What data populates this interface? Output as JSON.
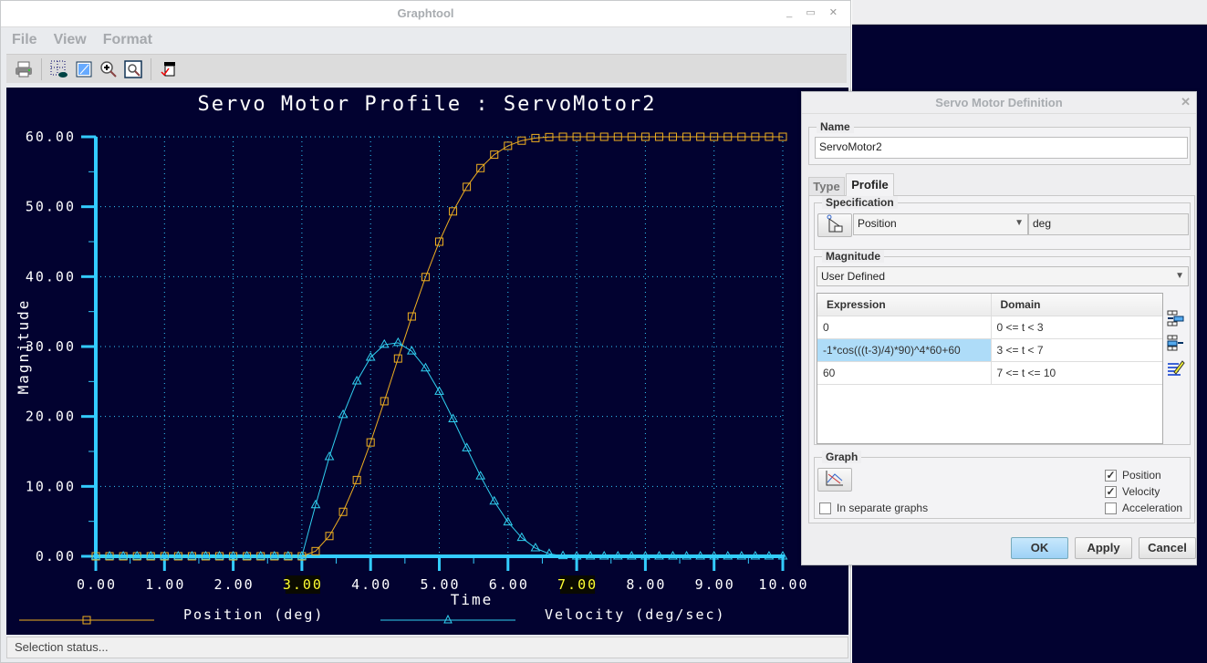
{
  "graphtool": {
    "title": "Graphtool",
    "menu": [
      "File",
      "View",
      "Format"
    ],
    "toolbar": [
      "printer-icon",
      "view-grid-icon",
      "edit-icon",
      "zoom-in-icon",
      "zoom-fit-icon",
      "export-icon"
    ],
    "status": "Selection status..."
  },
  "dialog": {
    "title": "Servo Motor Definition",
    "name_label": "Name",
    "name_value": "ServoMotor2",
    "tabs": [
      "Type",
      "Profile"
    ],
    "active_tab": "Profile",
    "spec_label": "Specification",
    "spec_value": "Position",
    "spec_unit": "deg",
    "mag_label": "Magnitude",
    "mag_value": "User Defined",
    "table_headers": [
      "Expression",
      "Domain"
    ],
    "rows": [
      {
        "expr": "0",
        "domain": "0 <= t < 3"
      },
      {
        "expr": "-1*cos(((t-3)/4)*90)^4*60+60",
        "domain": "3 <= t < 7"
      },
      {
        "expr": "60",
        "domain": "7 <= t <= 10"
      }
    ],
    "graph_label": "Graph",
    "separate": "In separate graphs",
    "checks": [
      {
        "label": "Position",
        "checked": true
      },
      {
        "label": "Velocity",
        "checked": true
      },
      {
        "label": "Acceleration",
        "checked": false
      }
    ],
    "ok": "OK",
    "apply": "Apply",
    "cancel": "Cancel"
  },
  "chart_data": {
    "type": "line",
    "title": "Servo Motor Profile : ServoMotor2",
    "xlabel": "Time",
    "ylabel": "Magnitude",
    "xlim": [
      0,
      10
    ],
    "ylim": [
      0,
      60
    ],
    "grid": true,
    "xticks": [
      "0.00",
      "1.00",
      "2.00",
      "3.00",
      "4.00",
      "5.00",
      "6.00",
      "7.00",
      "8.00",
      "9.00",
      "10.00"
    ],
    "yticks": [
      "0.00",
      "10.00",
      "20.00",
      "30.00",
      "40.00",
      "50.00",
      "60.00"
    ],
    "highlighted_xticks": [
      "3.00",
      "7.00"
    ],
    "legend_placement": "bottom",
    "x": [
      0,
      0.2,
      0.4,
      0.6,
      0.8,
      1,
      1.2,
      1.4,
      1.6,
      1.8,
      2,
      2.2,
      2.4,
      2.6,
      2.8,
      3,
      3.2,
      3.4,
      3.6,
      3.8,
      4,
      4.2,
      4.4,
      4.6,
      4.8,
      5,
      5.2,
      5.4,
      5.6,
      5.8,
      6,
      6.2,
      6.4,
      6.6,
      6.8,
      7,
      7.2,
      7.4,
      7.6,
      7.8,
      8,
      8.2,
      8.4,
      8.6,
      8.8,
      9,
      9.2,
      9.4,
      9.6,
      9.8,
      10
    ],
    "series": [
      {
        "name": "Position (deg)",
        "color": "#f0b020",
        "marker": "square",
        "values": [
          0,
          0,
          0,
          0,
          0,
          0,
          0,
          0,
          0,
          0,
          0,
          0,
          0,
          0,
          0,
          0,
          0.74,
          2.9,
          6.36,
          10.91,
          16.29,
          22.18,
          28.29,
          34.3,
          39.94,
          45.0,
          49.33,
          52.84,
          55.53,
          57.45,
          58.71,
          59.45,
          59.82,
          59.96,
          60,
          60,
          60,
          60,
          60,
          60,
          60,
          60,
          60,
          60,
          60,
          60,
          60,
          60,
          60,
          60,
          60
        ]
      },
      {
        "name": "Velocity (deg/sec)",
        "color": "#30d0f0",
        "marker": "triangle",
        "values": [
          0,
          0,
          0,
          0,
          0,
          0,
          0,
          0,
          0,
          0,
          0,
          0,
          0,
          0,
          0,
          0,
          7.33,
          14.21,
          20.23,
          25.05,
          28.44,
          30.27,
          30.53,
          29.33,
          26.91,
          23.56,
          19.63,
          15.48,
          11.46,
          7.86,
          4.88,
          2.65,
          1.17,
          0.36,
          0.05,
          0,
          0,
          0,
          0,
          0,
          0,
          0,
          0,
          0,
          0,
          0,
          0,
          0,
          0,
          0,
          0
        ]
      }
    ]
  }
}
